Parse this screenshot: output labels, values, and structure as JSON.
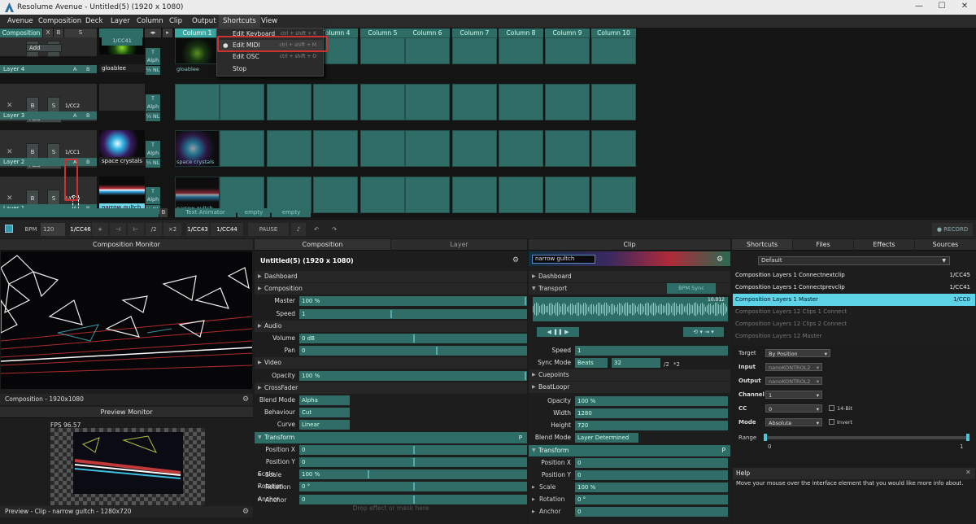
{
  "window": {
    "title": "Resolume Avenue - Untitled(5) (1920 x 1080)",
    "min": "—",
    "max": "☐",
    "close": "✕"
  },
  "menu": [
    "Avenue",
    "Composition",
    "Deck",
    "Layer",
    "Column",
    "Clip",
    "Output",
    "Shortcuts",
    "View"
  ],
  "deck": {
    "header": {
      "composition": "Composition",
      "x": "X",
      "b": "B",
      "s": "S",
      "columns": [
        "Column 1",
        "Column 2",
        "Column 3",
        "Column 4",
        "Column 5",
        "Column 6",
        "Column 7",
        "Column 8",
        "Column 9",
        "Column 10"
      ],
      "cc41": "1/CC41"
    },
    "layers": [
      {
        "name": "Layer 4",
        "cc": "",
        "clip": "gloablee",
        "add": "Add"
      },
      {
        "name": "Layer 3",
        "cc": "1/CC2",
        "clip": "",
        "add": "Add"
      },
      {
        "name": "Layer 2",
        "cc": "1/CC1",
        "clip": "space crystals",
        "add": "Add"
      },
      {
        "name": "Layer 1",
        "cc": "1/CC0",
        "clip": "narrow gultch",
        "add": "Add"
      }
    ],
    "btn_x": "X",
    "btn_b": "B",
    "btn_s": "S",
    "btn_a": "A",
    "btn_t": "T",
    "btn_alph": "Alph",
    "cc_small": "⅓ NL",
    "footer": {
      "text_animator": "Text Animator",
      "empty": "empty",
      "a": "A",
      "b": "B"
    }
  },
  "shortcuts_menu": {
    "items": [
      {
        "label": "Edit Keyboard",
        "shortcut": "ctrl + shift + K"
      },
      {
        "label": "Edit MIDI",
        "shortcut": "ctrl + shift + M"
      },
      {
        "label": "Edit OSC",
        "shortcut": "ctrl + shift + O"
      },
      {
        "label": "Stop",
        "shortcut": ""
      }
    ]
  },
  "transport": {
    "bpm_label": "BPM",
    "bpm": "120",
    "cc46": "1/CC46",
    "plus": "+",
    "tapl": "⊣",
    "tapr": "⊢",
    "div2": "/2",
    "mul2": "×2",
    "cc43": "1/CC43",
    "cc44": "1/CC44",
    "pause": "PAUSE",
    "record": "● RECORD"
  },
  "comp_monitor": {
    "title": "Composition Monitor",
    "status": "Composition - 1920x1080"
  },
  "preview_monitor": {
    "title": "Preview Monitor",
    "fps": "FPS 96.57",
    "status": "Preview - Clip - narrow gultch - 1280x720"
  },
  "composition": {
    "tab1": "Composition",
    "tab2": "Layer",
    "name": "Untitled(5) (1920 x 1080)",
    "dashboard": "Dashboard",
    "comp_sect": "Composition",
    "master": "Master",
    "master_val": "100 %",
    "speed": "Speed",
    "speed_val": "1",
    "audio": "Audio",
    "volume": "Volume",
    "volume_val": "0 dB",
    "pan": "Pan",
    "pan_val": "0",
    "video": "Video",
    "opacity": "Opacity",
    "opacity_val": "100 %",
    "crossfader": "CrossFader",
    "blend_mode": "Blend Mode",
    "blend_val": "Alpha",
    "behaviour": "Behaviour",
    "behaviour_val": "Cut",
    "curve": "Curve",
    "curve_val": "Linear",
    "transform": "Transform",
    "posx": "Position X",
    "posx_val": "0",
    "posy": "Position Y",
    "posy_val": "0",
    "scale": "Scale",
    "scale_val": "100 %",
    "rotation": "Rotation",
    "rotation_val": "0 °",
    "anchor": "Anchor",
    "anchor_val": "0",
    "drop_hint": "Drop effect or mask here",
    "p": "P"
  },
  "clip": {
    "title": "Clip",
    "name": "narrow gultch",
    "dashboard": "Dashboard",
    "transport": "Transport",
    "bpm_sync": "BPM Sync",
    "time": "10.012",
    "speed": "Speed",
    "speed_val": "1",
    "sync_mode": "Sync Mode",
    "sync_val": "Beats",
    "beats": "32",
    "div2": "/2",
    "mul2": "*2",
    "cuepoints": "Cuepoints",
    "beatloopr": "BeatLoopr",
    "opacity": "Opacity",
    "opacity_val": "100 %",
    "width": "Width",
    "width_val": "1280",
    "height": "Height",
    "height_val": "720",
    "blend_mode": "Blend Mode",
    "blend_val": "Layer Determined",
    "transform": "Transform",
    "posx": "Position X",
    "posx_val": "0",
    "posy": "Position Y",
    "posy_val": "0",
    "scale": "Scale",
    "scale_val": "100 %",
    "rotation": "Rotation",
    "rotation_val": "0 °",
    "anchor": "Anchor",
    "anchor_val": "0",
    "p": "P"
  },
  "right": {
    "tabs": [
      "Shortcuts",
      "Files",
      "Effects",
      "Sources"
    ],
    "preset": "Default",
    "shortcuts": [
      {
        "name": "Composition Layers 1 Connectnextclip",
        "val": "1/CC45"
      },
      {
        "name": "Composition Layers 1 Connectprevclip",
        "val": "1/CC41"
      },
      {
        "name": "Composition Layers 1 Master",
        "val": "1/CC0"
      },
      {
        "name": "Composition Layers 12 Clips 1 Connect",
        "val": ""
      },
      {
        "name": "Composition Layers 12 Clips 2 Connect",
        "val": ""
      },
      {
        "name": "Composition Layers 12 Master",
        "val": ""
      }
    ],
    "target": "Target",
    "target_val": "By Position",
    "input": "Input",
    "input_val": "nanoKONTROL2",
    "output": "Output",
    "output_val": "nanoKONTROL2",
    "channel": "Channel",
    "channel_val": "1",
    "cc": "CC",
    "cc_val": "0",
    "bit14": "14-Bit",
    "mode": "Mode",
    "mode_val": "Absolute",
    "invert": "Invert",
    "range": "Range",
    "range_min": "0",
    "range_max": "1",
    "help_title": "Help",
    "help_text": "Move your mouse over the interface element that you would like more info about."
  }
}
